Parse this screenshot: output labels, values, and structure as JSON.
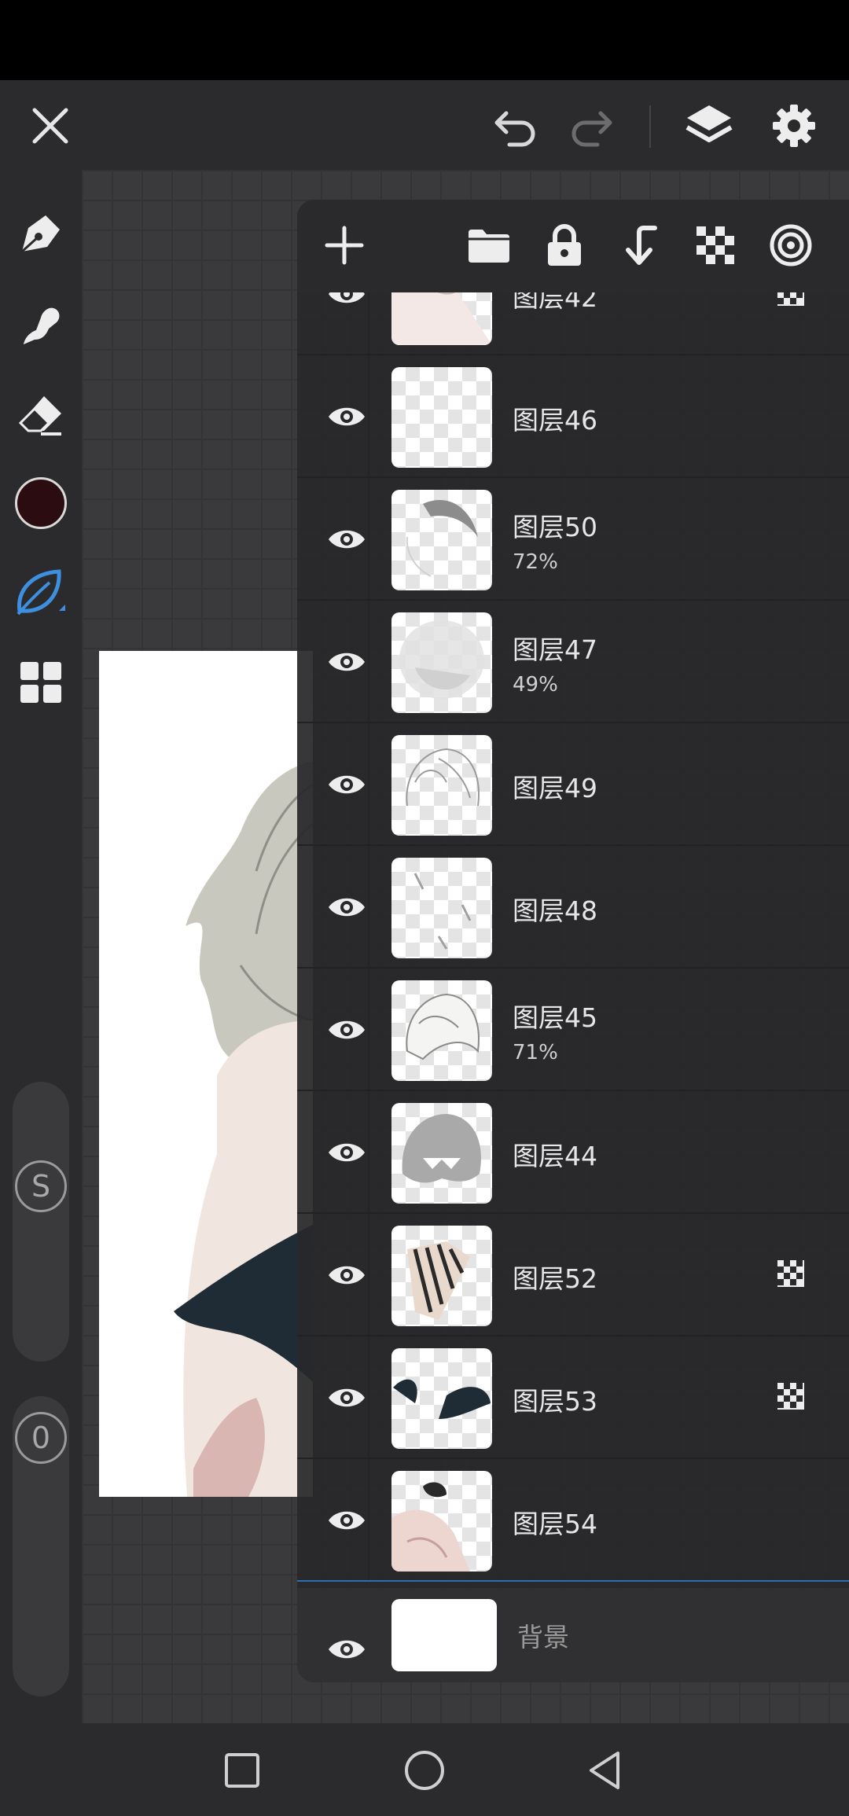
{
  "app": {
    "toolbar": {
      "close_icon": "close-icon",
      "undo_icon": "undo-icon",
      "redo_icon": "redo-icon",
      "layers_icon": "layers-icon",
      "settings_icon": "gear-icon"
    },
    "left_tools": [
      "pen-icon",
      "smudge-icon",
      "eraser-icon",
      "color-swatch",
      "brush-leaf-icon",
      "grid-menu-icon"
    ],
    "current_color": "#2b0c10",
    "accent_color": "#3d8fe0",
    "size_slider_label": "S",
    "opacity_slider_label": "0"
  },
  "layers_panel": {
    "actions": [
      "add-icon",
      "folder-icon",
      "lock-icon",
      "merge-down-icon",
      "alpha-lock-icon",
      "blend-icon"
    ],
    "layers": [
      {
        "name": "图层42",
        "opacity": "",
        "alpha_locked": true,
        "visible": true
      },
      {
        "name": "图层46",
        "opacity": "",
        "alpha_locked": false,
        "visible": true
      },
      {
        "name": "图层50",
        "opacity": "72%",
        "alpha_locked": false,
        "visible": true
      },
      {
        "name": "图层47",
        "opacity": "49%",
        "alpha_locked": false,
        "visible": true
      },
      {
        "name": "图层49",
        "opacity": "",
        "alpha_locked": false,
        "visible": true
      },
      {
        "name": "图层48",
        "opacity": "",
        "alpha_locked": false,
        "visible": true
      },
      {
        "name": "图层45",
        "opacity": "71%",
        "alpha_locked": false,
        "visible": true
      },
      {
        "name": "图层44",
        "opacity": "",
        "alpha_locked": false,
        "visible": true
      },
      {
        "name": "图层52",
        "opacity": "",
        "alpha_locked": true,
        "visible": true
      },
      {
        "name": "图层53",
        "opacity": "",
        "alpha_locked": true,
        "visible": true
      },
      {
        "name": "图层54",
        "opacity": "",
        "alpha_locked": false,
        "visible": true
      }
    ],
    "background": {
      "name": "背景",
      "visible": true
    }
  },
  "system_nav": [
    "recents-button",
    "home-button",
    "back-button"
  ]
}
